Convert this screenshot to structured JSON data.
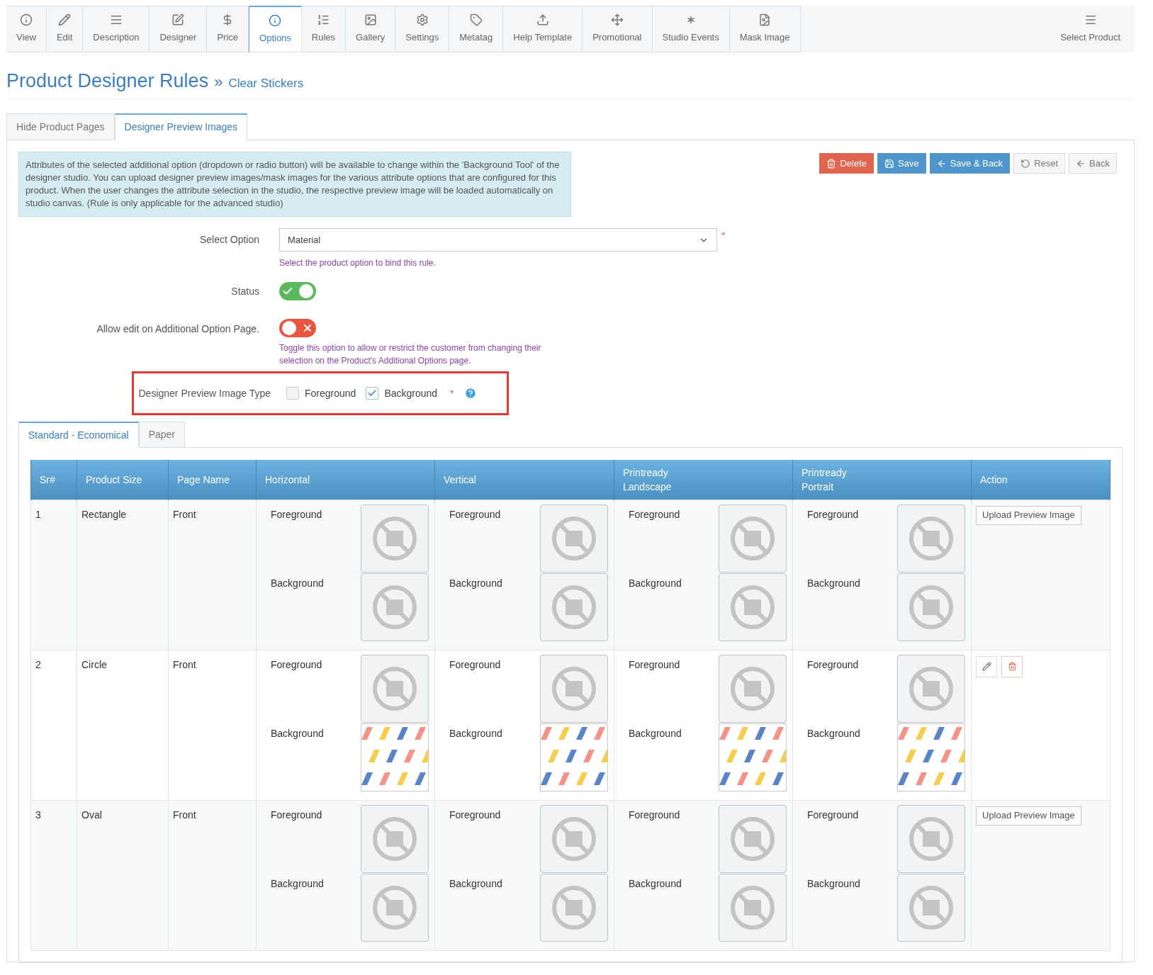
{
  "nav": {
    "tabs": [
      {
        "label": "View",
        "selected": false
      },
      {
        "label": "Edit",
        "selected": false
      },
      {
        "label": "Description",
        "selected": false
      },
      {
        "label": "Designer",
        "selected": false
      },
      {
        "label": "Price",
        "selected": false
      },
      {
        "label": "Options",
        "selected": true
      },
      {
        "label": "Rules",
        "selected": false
      },
      {
        "label": "Gallery",
        "selected": false
      },
      {
        "label": "Settings",
        "selected": false
      },
      {
        "label": "Metatag",
        "selected": false
      },
      {
        "label": "Help Template",
        "selected": false
      },
      {
        "label": "Promotional",
        "selected": false
      },
      {
        "label": "Studio Events",
        "selected": false
      },
      {
        "label": "Mask Image",
        "selected": false
      }
    ],
    "select_product": "Select Product"
  },
  "title": "Product Designer Rules",
  "breadcrumb_sep": "»",
  "breadcrumb": "Clear Stickers",
  "subtabs": [
    {
      "label": "Hide Product Pages",
      "selected": false
    },
    {
      "label": "Designer Preview Images",
      "selected": true
    }
  ],
  "info": "Attributes of the selected additional option (dropdown or radio button) will be available to change within the 'Background Tool' of the designer studio. You can upload designer preview images/mask images for the various attribute options that are configured for this product. When the user changes the attribute selection in the studio, the respective preview image will be loaded automatically on studio canvas. (Rule is only applicable for the advanced studio)",
  "buttons": [
    {
      "label": "Delete",
      "kind": "delete"
    },
    {
      "label": "Save",
      "kind": "save"
    },
    {
      "label": "Save & Back",
      "kind": "save_back"
    },
    {
      "label": "Reset",
      "kind": "reset"
    },
    {
      "label": "Back",
      "kind": "back"
    }
  ],
  "form": {
    "select_option": {
      "label": "Select Option",
      "value": "Material",
      "required": "*",
      "help": "Select the product option to bind this rule."
    },
    "status": {
      "label": "Status",
      "on": true
    },
    "allow_edit": {
      "label": "Allow edit on Additional Option Page.",
      "on": false,
      "help": "Toggle this option to allow or restrict the customer from changing their selection on the Product's Additional Options page."
    },
    "image_type": {
      "label": "Designer Preview Image Type",
      "required": "*",
      "options": [
        {
          "label": "Foreground",
          "checked": false
        },
        {
          "label": "Background",
          "checked": true
        }
      ]
    }
  },
  "inner_tabs": [
    {
      "label": "Standard - Economical",
      "selected": true
    },
    {
      "label": "Paper",
      "selected": false
    }
  ],
  "table": {
    "columns": [
      "Sr#",
      "Product Size",
      "Page Name",
      "Horizontal",
      "Vertical",
      "Printready Landscape",
      "Printready Portrait",
      "Action"
    ],
    "rows": [
      {
        "cells": [
          "1",
          "Rectangle",
          "Front",
          {
            "fg": "Foreground",
            "bg": "Background",
            "bg_image": {
              "kind": "none"
            }
          },
          {
            "fg": "Foreground",
            "bg": "Background",
            "bg_image": {
              "kind": "none"
            }
          },
          {
            "fg": "Foreground",
            "bg": "Background",
            "bg_image": {
              "kind": "none"
            }
          },
          {
            "fg": "Foreground",
            "bg": "Background",
            "bg_image": {
              "kind": "none"
            }
          },
          {
            "kind": "upload",
            "label": "Upload Preview Image"
          }
        ]
      },
      {
        "cells": [
          "2",
          "Circle",
          "Front",
          {
            "fg": "Foreground",
            "bg": "Background",
            "bg_image": {
              "kind": "pattern"
            }
          },
          {
            "fg": "Foreground",
            "bg": "Background",
            "bg_image": {
              "kind": "pattern"
            }
          },
          {
            "fg": "Foreground",
            "bg": "Background",
            "bg_image": {
              "kind": "pattern"
            }
          },
          {
            "fg": "Foreground",
            "bg": "Background",
            "bg_image": {
              "kind": "pattern"
            }
          },
          {
            "kind": "edit_delete"
          }
        ]
      },
      {
        "cells": [
          "3",
          "Oval",
          "Front",
          {
            "fg": "Foreground",
            "bg": "Background",
            "bg_image": {
              "kind": "none"
            }
          },
          {
            "fg": "Foreground",
            "bg": "Background",
            "bg_image": {
              "kind": "none"
            }
          },
          {
            "fg": "Foreground",
            "bg": "Background",
            "bg_image": {
              "kind": "none"
            }
          },
          {
            "fg": "Foreground",
            "bg": "Background",
            "bg_image": {
              "kind": "none"
            }
          },
          {
            "kind": "upload",
            "label": "Upload Preview Image"
          }
        ]
      }
    ]
  }
}
